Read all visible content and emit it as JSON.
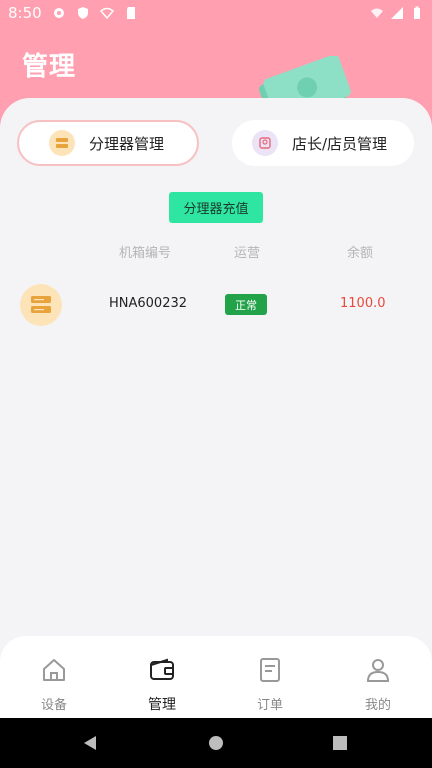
{
  "status_bar": {
    "time": "8:50"
  },
  "header": {
    "title": "管理"
  },
  "tabs": [
    {
      "label": "分理器管理",
      "active": true
    },
    {
      "label": "店长/店员管理",
      "active": false
    }
  ],
  "actions": {
    "recharge_label": "分理器充值"
  },
  "table": {
    "headers": [
      "机箱编号",
      "运营",
      "余额"
    ],
    "rows": [
      {
        "code": "HNA600232",
        "status": "正常",
        "balance": "1100.0"
      }
    ]
  },
  "bottom_nav": [
    {
      "label": "设备",
      "icon": "home-icon",
      "active": false
    },
    {
      "label": "管理",
      "icon": "wallet-icon",
      "active": true
    },
    {
      "label": "订单",
      "icon": "document-icon",
      "active": false
    },
    {
      "label": "我的",
      "icon": "user-icon",
      "active": false
    }
  ],
  "colors": {
    "header_bg": "#ff9fb0",
    "recharge_bg": "#2ee6a1",
    "status_green": "#22a34a",
    "balance_red": "#e74a3b"
  }
}
